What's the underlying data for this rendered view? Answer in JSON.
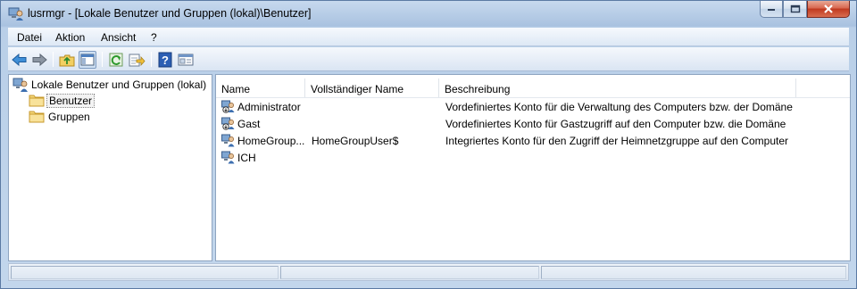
{
  "window": {
    "title": "lusrmgr - [Lokale Benutzer und Gruppen (lokal)\\Benutzer]"
  },
  "menubar": {
    "items": [
      "Datei",
      "Aktion",
      "Ansicht",
      "?"
    ]
  },
  "toolbar": {
    "buttons": [
      "back-icon",
      "forward-icon",
      "up-folder-icon",
      "show-hide-tree-icon",
      "refresh-icon",
      "export-list-icon",
      "help-icon",
      "properties-icon"
    ]
  },
  "tree": {
    "root": "Lokale Benutzer und Gruppen (lokal)",
    "children": [
      "Benutzer",
      "Gruppen"
    ],
    "selected": "Benutzer"
  },
  "list": {
    "columns": [
      "Name",
      "Vollständiger Name",
      "Beschreibung"
    ],
    "rows": [
      {
        "name": "Administrator",
        "full_name": "",
        "description": "Vordefiniertes Konto für die Verwaltung des Computers bzw. der Domäne",
        "icon": "disabled-user-icon"
      },
      {
        "name": "Gast",
        "full_name": "",
        "description": "Vordefiniertes Konto für Gastzugriff auf den Computer bzw. die Domäne",
        "icon": "disabled-user-icon"
      },
      {
        "name": "HomeGroup...",
        "full_name": "HomeGroupUser$",
        "description": "Integriertes Konto für den Zugriff der Heimnetzgruppe auf den Computer",
        "icon": "user-icon"
      },
      {
        "name": "ICH",
        "full_name": "",
        "description": "",
        "icon": "user-icon"
      }
    ]
  },
  "colors": {
    "selection": "#f3f3f3",
    "frame": "#b9cfe8",
    "close_button": "#c0391f"
  }
}
